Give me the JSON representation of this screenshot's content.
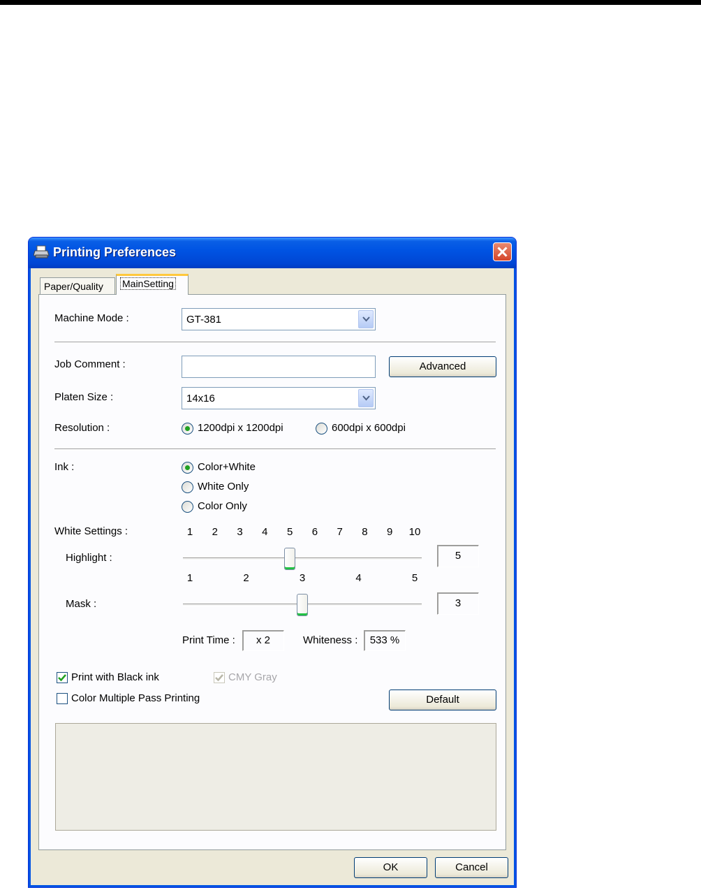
{
  "window": {
    "title": "Printing Preferences"
  },
  "tabs": [
    {
      "label": "Paper/Quality"
    },
    {
      "label": "MainSetting"
    }
  ],
  "machine_mode": {
    "label": "Machine Mode :",
    "value": "GT-381"
  },
  "job_comment": {
    "label": "Job Comment :",
    "value": "",
    "advanced_button": "Advanced"
  },
  "platen_size": {
    "label": "Platen Size :",
    "value": "14x16"
  },
  "resolution": {
    "label": "Resolution :",
    "options": [
      {
        "label": "1200dpi x 1200dpi",
        "selected": true
      },
      {
        "label": "600dpi x 600dpi",
        "selected": false
      }
    ]
  },
  "ink": {
    "label": "Ink :",
    "options": [
      {
        "label": "Color+White",
        "selected": true
      },
      {
        "label": "White Only",
        "selected": false
      },
      {
        "label": "Color Only",
        "selected": false
      }
    ]
  },
  "white_settings": {
    "label": "White Settings :",
    "highlight": {
      "label": "Highlight :",
      "ticks": [
        "1",
        "2",
        "3",
        "4",
        "5",
        "6",
        "7",
        "8",
        "9",
        "10"
      ],
      "value": "5",
      "min": 1,
      "max": 10,
      "level": 5
    },
    "mask": {
      "label": "Mask :",
      "ticks": [
        "1",
        "2",
        "3",
        "4",
        "5"
      ],
      "value": "3",
      "min": 1,
      "max": 5,
      "level": 3
    },
    "print_time_label": "Print Time :",
    "print_time_value": "x 2",
    "whiteness_label": "Whiteness :",
    "whiteness_value": "533 %"
  },
  "options": {
    "print_black_ink": {
      "label": "Print with Black ink",
      "checked": true
    },
    "cmy_gray": {
      "label": "CMY Gray",
      "checked": true,
      "enabled": false
    },
    "color_multiple_pass": {
      "label": "Color Multiple Pass Printing",
      "checked": false
    },
    "default_button": "Default"
  },
  "footer": {
    "ok": "OK",
    "cancel": "Cancel"
  },
  "colors": {
    "titlebar": "#0054e3",
    "dialog_bg": "#ece9d8",
    "radio_dot": "#21a121",
    "check": "#21a121",
    "thumb_accent": "#21c143"
  }
}
